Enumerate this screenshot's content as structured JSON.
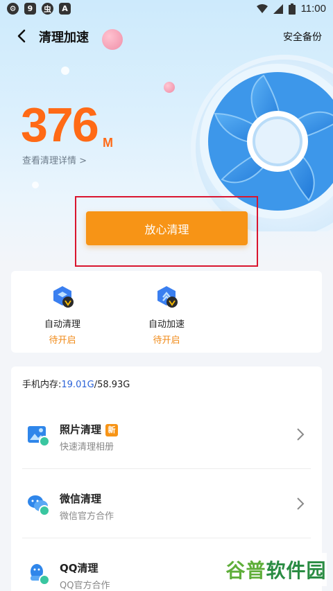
{
  "status_bar": {
    "time": "11:00"
  },
  "header": {
    "back_label": "‹",
    "title": "清理加速",
    "backup_label": "安全备份"
  },
  "cleanable": {
    "size": "376",
    "unit": "M",
    "detail_link": "查看清理详情 >"
  },
  "clean_button": {
    "label": "放心清理"
  },
  "features": [
    {
      "icon": "auto-clean-icon",
      "label": "自动清理",
      "status": "待开启"
    },
    {
      "icon": "auto-speedup-icon",
      "label": "自动加速",
      "status": "待开启"
    }
  ],
  "memory": {
    "label": "手机内存:",
    "used": "19.01G",
    "total": "/58.93G"
  },
  "list_items": [
    {
      "icon": "photo-clean-icon",
      "title": "照片清理",
      "badge": "新",
      "subtitle": "快速清理相册"
    },
    {
      "icon": "wechat-clean-icon",
      "title": "微信清理",
      "subtitle": "微信官方合作"
    },
    {
      "icon": "qq-clean-icon",
      "title": "QQ清理",
      "subtitle": "QQ官方合作"
    }
  ],
  "watermark": {
    "part1": "谷普",
    "part2": "软件园"
  },
  "colors": {
    "accent_orange": "#f79416",
    "size_orange": "#ff6a16",
    "link_blue": "#2a62d8",
    "highlight_red": "#d9142e"
  }
}
